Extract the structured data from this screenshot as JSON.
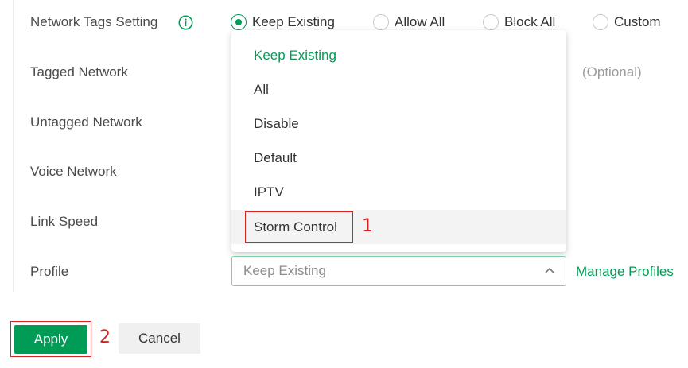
{
  "form": {
    "network_tags_label": "Network Tags Setting",
    "tagged_network_label": "Tagged Network",
    "untagged_network_label": "Untagged Network",
    "voice_network_label": "Voice Network",
    "link_speed_label": "Link Speed",
    "profile_label": "Profile",
    "network_tags_options": [
      "Keep Existing",
      "Allow All",
      "Block All",
      "Custom"
    ],
    "network_tags_selected": "Keep Existing",
    "tagged_network_hint": "(Optional)"
  },
  "profile_dropdown": {
    "items": [
      "Keep Existing",
      "All",
      "Disable",
      "Default",
      "IPTV",
      "Storm Control"
    ],
    "selected": "Keep Existing",
    "hovered": "Storm Control"
  },
  "profile_select": {
    "value": "Keep Existing"
  },
  "links": {
    "manage_profiles": "Manage Profiles"
  },
  "buttons": {
    "apply": "Apply",
    "cancel": "Cancel"
  },
  "annotations": {
    "step1": "1",
    "step2": "2"
  },
  "colors": {
    "accent": "#009b55",
    "annotation": "#d92323"
  }
}
